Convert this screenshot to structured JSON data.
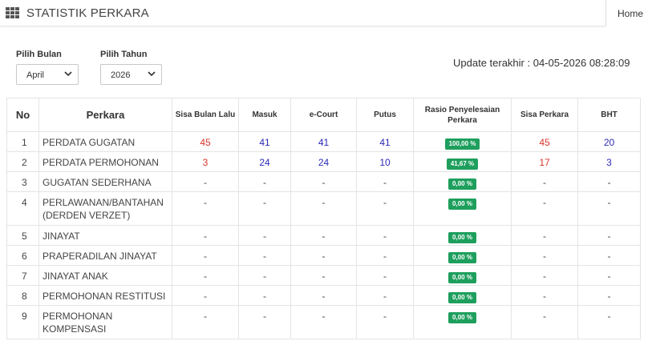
{
  "header": {
    "title": "STATISTIK PERKARA",
    "home_label": "Home"
  },
  "filters": {
    "bulan_label": "Pilih Bulan",
    "bulan_value": "April",
    "tahun_label": "Pilih Tahun",
    "tahun_value": "2026"
  },
  "update_text": "Update terakhir : 04-05-2026 08:28:09",
  "colors": {
    "red_value": "#d9342b",
    "blue_value": "#2a2ab5",
    "badge_green": "#1e9f5d"
  },
  "table": {
    "headers": {
      "no": "No",
      "perkara": "Perkara",
      "sisa_bulan_lalu": "Sisa Bulan Lalu",
      "masuk": "Masuk",
      "ecourt": "e-Court",
      "putus": "Putus",
      "rasio": "Rasio Penyelesaian Perkara",
      "sisa_perkara": "Sisa Perkara",
      "bht": "BHT"
    },
    "rows": [
      {
        "no": "1",
        "perkara": "PERDATA GUGATAN",
        "sisa_bulan_lalu": "45",
        "masuk": "41",
        "ecourt": "41",
        "putus": "41",
        "rasio": "100,00 %",
        "sisa_perkara": "45",
        "bht": "20"
      },
      {
        "no": "2",
        "perkara": "PERDATA PERMOHONAN",
        "sisa_bulan_lalu": "3",
        "masuk": "24",
        "ecourt": "24",
        "putus": "10",
        "rasio": "41,67 %",
        "sisa_perkara": "17",
        "bht": "3"
      },
      {
        "no": "3",
        "perkara": "GUGATAN SEDERHANA",
        "sisa_bulan_lalu": "-",
        "masuk": "-",
        "ecourt": "-",
        "putus": "-",
        "rasio": "0,00 %",
        "sisa_perkara": "-",
        "bht": "-"
      },
      {
        "no": "4",
        "perkara": "PERLAWANAN/BANTAHAN (DERDEN VERZET)",
        "sisa_bulan_lalu": "-",
        "masuk": "-",
        "ecourt": "-",
        "putus": "-",
        "rasio": "0,00 %",
        "sisa_perkara": "-",
        "bht": "-"
      },
      {
        "no": "5",
        "perkara": "JINAYAT",
        "sisa_bulan_lalu": "-",
        "masuk": "-",
        "ecourt": "-",
        "putus": "-",
        "rasio": "0,00 %",
        "sisa_perkara": "-",
        "bht": "-"
      },
      {
        "no": "6",
        "perkara": "PRAPERADILAN JINAYAT",
        "sisa_bulan_lalu": "-",
        "masuk": "-",
        "ecourt": "-",
        "putus": "-",
        "rasio": "0,00 %",
        "sisa_perkara": "-",
        "bht": "-"
      },
      {
        "no": "7",
        "perkara": "JINAYAT ANAK",
        "sisa_bulan_lalu": "-",
        "masuk": "-",
        "ecourt": "-",
        "putus": "-",
        "rasio": "0,00 %",
        "sisa_perkara": "-",
        "bht": "-"
      },
      {
        "no": "8",
        "perkara": "PERMOHONAN RESTITUSI",
        "sisa_bulan_lalu": "-",
        "masuk": "-",
        "ecourt": "-",
        "putus": "-",
        "rasio": "0,00 %",
        "sisa_perkara": "-",
        "bht": "-"
      },
      {
        "no": "9",
        "perkara": "PERMOHONAN KOMPENSASI",
        "sisa_bulan_lalu": "-",
        "masuk": "-",
        "ecourt": "-",
        "putus": "-",
        "rasio": "0,00 %",
        "sisa_perkara": "-",
        "bht": "-"
      }
    ]
  }
}
